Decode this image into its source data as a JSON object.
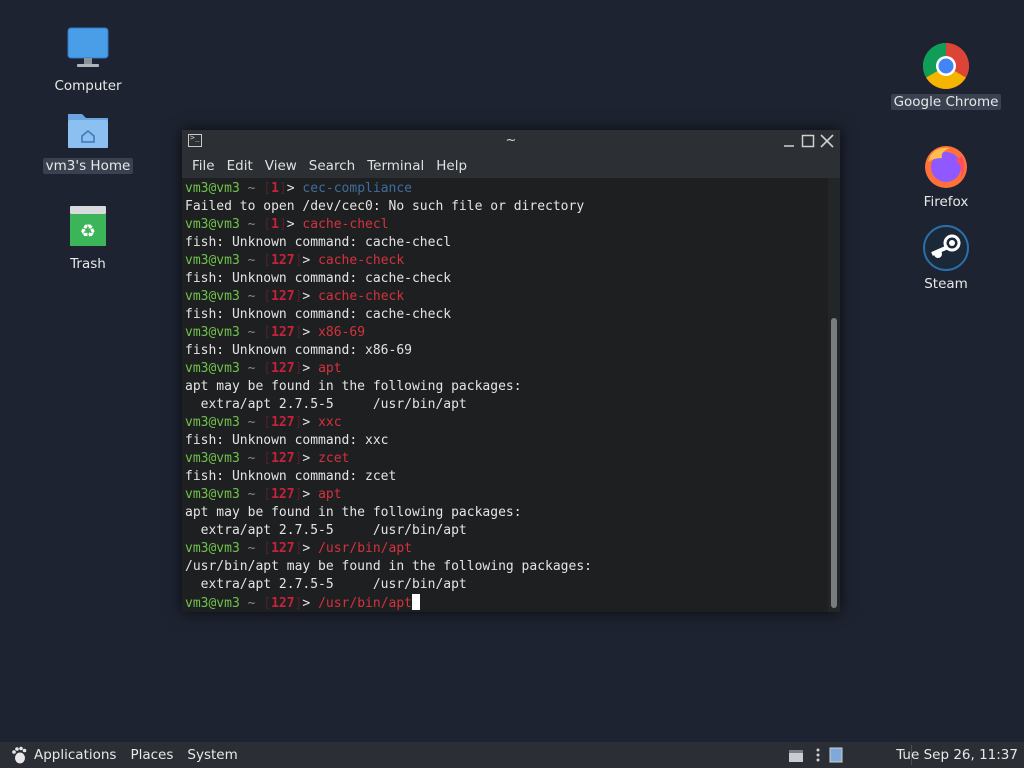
{
  "desktop": {
    "icons_left": [
      {
        "label": "Computer",
        "icon": "monitor-icon"
      },
      {
        "label": "vm3's Home",
        "icon": "home-folder-icon"
      },
      {
        "label": "Trash",
        "icon": "trash-icon"
      }
    ],
    "icons_right": [
      {
        "label": "Google Chrome",
        "icon": "chrome-icon"
      },
      {
        "label": "Firefox",
        "icon": "firefox-icon"
      },
      {
        "label": "Steam",
        "icon": "steam-icon"
      }
    ]
  },
  "window": {
    "title": "~",
    "menu": [
      "File",
      "Edit",
      "View",
      "Search",
      "Terminal",
      "Help"
    ]
  },
  "terminal": {
    "user": "vm3@vm3",
    "lines": [
      {
        "type": "prompt",
        "status": "1",
        "cmd": "cec-compliance",
        "cmd_class": "ok"
      },
      {
        "type": "out",
        "text": "Failed to open /dev/cec0: No such file or directory"
      },
      {
        "type": "prompt",
        "status": "1",
        "cmd": "cache-checl",
        "cmd_class": "err"
      },
      {
        "type": "out",
        "text": "fish: Unknown command: cache-checl"
      },
      {
        "type": "prompt",
        "status": "127",
        "cmd": "cache-check",
        "cmd_class": "err"
      },
      {
        "type": "out",
        "text": "fish: Unknown command: cache-check"
      },
      {
        "type": "prompt",
        "status": "127",
        "cmd": "cache-check",
        "cmd_class": "err"
      },
      {
        "type": "out",
        "text": "fish: Unknown command: cache-check"
      },
      {
        "type": "prompt",
        "status": "127",
        "cmd": "x86-69",
        "cmd_class": "err"
      },
      {
        "type": "out",
        "text": "fish: Unknown command: x86-69"
      },
      {
        "type": "prompt",
        "status": "127",
        "cmd": "apt",
        "cmd_class": "err"
      },
      {
        "type": "out",
        "text": "apt may be found in the following packages:"
      },
      {
        "type": "out",
        "text": "  extra/apt 2.7.5-5     /usr/bin/apt"
      },
      {
        "type": "prompt",
        "status": "127",
        "cmd": "xxc",
        "cmd_class": "err"
      },
      {
        "type": "out",
        "text": "fish: Unknown command: xxc"
      },
      {
        "type": "prompt",
        "status": "127",
        "cmd": "zcet",
        "cmd_class": "err"
      },
      {
        "type": "out",
        "text": "fish: Unknown command: zcet"
      },
      {
        "type": "prompt",
        "status": "127",
        "cmd": "apt",
        "cmd_class": "err"
      },
      {
        "type": "out",
        "text": "apt may be found in the following packages:"
      },
      {
        "type": "out",
        "text": "  extra/apt 2.7.5-5     /usr/bin/apt"
      },
      {
        "type": "prompt",
        "status": "127",
        "cmd": "/usr/bin/apt",
        "cmd_class": "err"
      },
      {
        "type": "out",
        "text": "/usr/bin/apt may be found in the following packages:"
      },
      {
        "type": "out",
        "text": "  extra/apt 2.7.5-5     /usr/bin/apt"
      },
      {
        "type": "prompt",
        "status": "127",
        "cmd": "/usr/bin/apt",
        "cmd_class": "err",
        "cursor": true
      }
    ]
  },
  "panel": {
    "menus": [
      "Applications",
      "Places",
      "System"
    ],
    "clock": "Tue Sep 26, 11:37"
  },
  "colors": {
    "desktop_bg": "#1d2330",
    "prompt_user": "#6fc24b",
    "status_code": "#c7223a",
    "cmd_valid": "#3f6d9d",
    "cmd_invalid": "#d4323d"
  }
}
